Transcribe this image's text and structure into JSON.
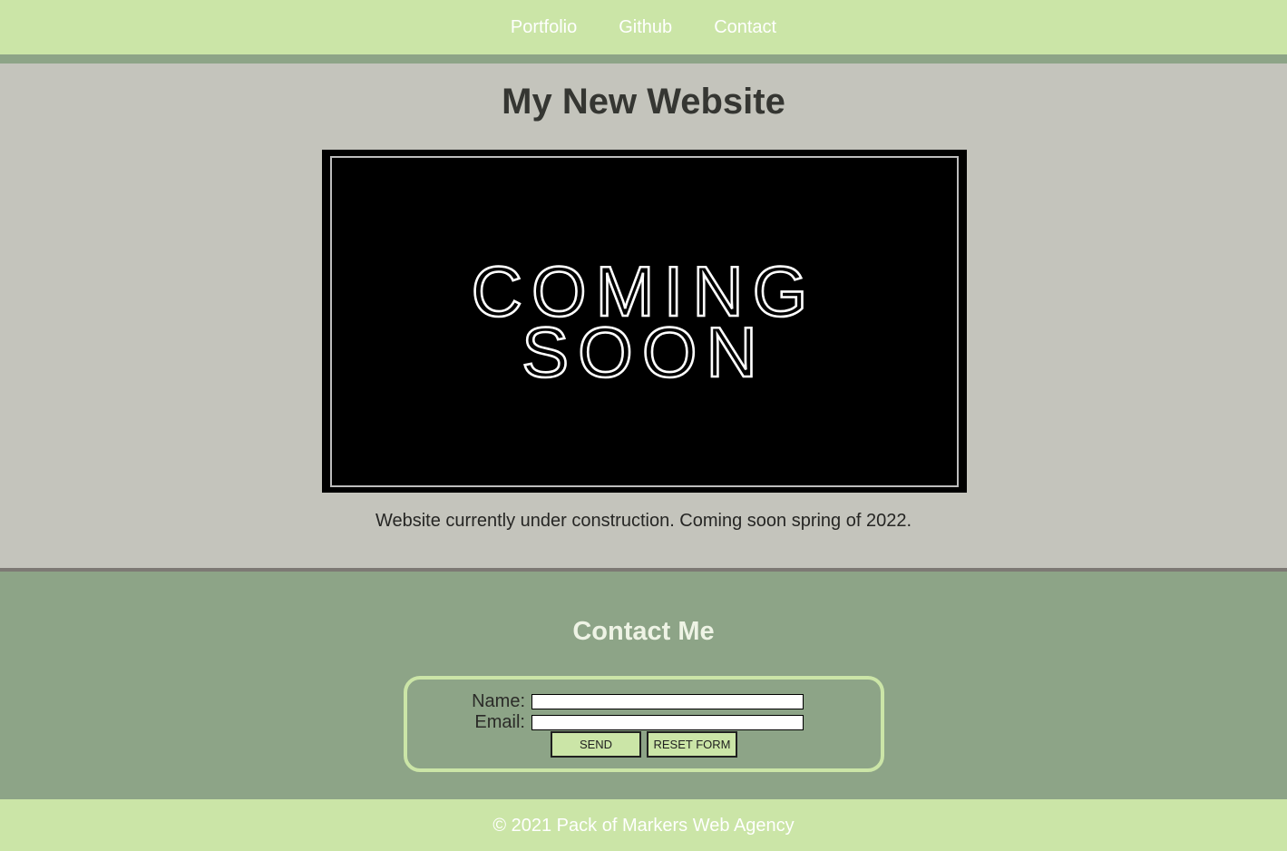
{
  "nav": {
    "items": [
      {
        "label": "Portfolio"
      },
      {
        "label": "Github"
      },
      {
        "label": "Contact"
      }
    ]
  },
  "main": {
    "title": "My New Website",
    "poster": {
      "line1": "COMING",
      "line2": "SOON"
    },
    "caption": "Website currently under construction. Coming soon spring of 2022."
  },
  "contact": {
    "title": "Contact Me",
    "name_label": "Name:",
    "name_value": "",
    "email_label": "Email:",
    "email_value": "",
    "send_label": "SEND",
    "reset_label": "RESET FORM"
  },
  "footer": {
    "text": "© 2021 Pack of Markers Web Agency"
  },
  "colors": {
    "nav_bg": "#cbe5a7",
    "accent_green": "#8da487",
    "main_bg": "#c4c4bc",
    "title_text": "#353632"
  }
}
